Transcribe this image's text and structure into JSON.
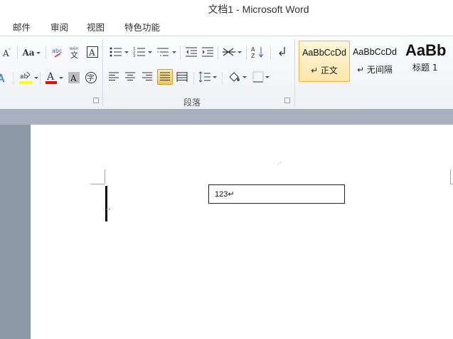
{
  "window": {
    "title": "文档1 - Microsoft Word"
  },
  "tabs": [
    "邮件",
    "审阅",
    "视图",
    "特色功能"
  ],
  "paragraph_group": {
    "label": "段落"
  },
  "styles": [
    {
      "sample": "AaBbCcDd",
      "name": "↵ 正文",
      "selected": true
    },
    {
      "sample": "AaBbCcDd",
      "name": "↵ 无间隔",
      "selected": false
    },
    {
      "sample": "AaBb",
      "name": "标题 1",
      "selected": false
    }
  ],
  "font_tools": {
    "font_size_label": "Aa"
  },
  "document": {
    "textbox_text": "123↵",
    "paragraph_mark": "↵",
    "dot_mark": "·ˈ"
  },
  "colors": {
    "highlight": "#ffff00",
    "font_color": "#ff0000",
    "workspace": "#8d98a6"
  }
}
